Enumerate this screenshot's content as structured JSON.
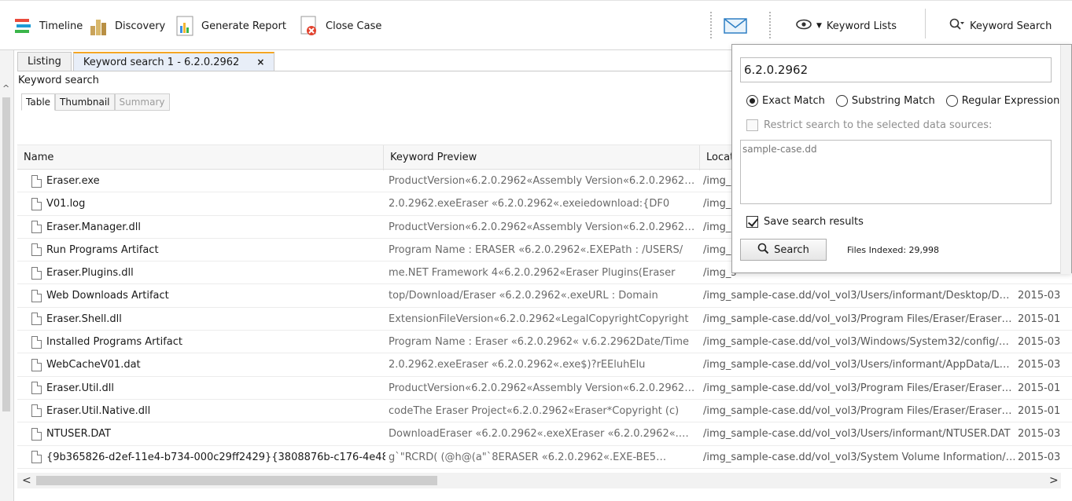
{
  "toolbar": {
    "timeline": "Timeline",
    "discovery": "Discovery",
    "generate_report": "Generate Report",
    "close_case": "Close Case",
    "keyword_lists": "Keyword Lists",
    "keyword_search": "Keyword Search"
  },
  "tabs": {
    "listing": "Listing",
    "keyword_search": "Keyword search 1 - 6.2.0.2962",
    "close": "×"
  },
  "section_label": "Keyword search",
  "subtabs": {
    "table": "Table",
    "thumbnail": "Thumbnail",
    "summary": "Summary"
  },
  "table": {
    "headers": {
      "name": "Name",
      "preview": "Keyword Preview",
      "location": "Locat"
    },
    "rows": [
      {
        "name": "Eraser.exe",
        "preview": "ProductVersion«6.2.0.2962«Assembly Version«6.2.0.2962…",
        "location": "/img_s",
        "date": ""
      },
      {
        "name": "V01.log",
        "preview": "2.0.2962.exeEraser «6.2.0.2962«.exeiedownload:{DF0",
        "location": "/img_s",
        "date": ""
      },
      {
        "name": "Eraser.Manager.dll",
        "preview": "ProductVersion«6.2.0.2962«Assembly Version«6.2.0.2962…",
        "location": "/img_s",
        "date": ""
      },
      {
        "name": "Run Programs Artifact",
        "preview": "Program Name : ERASER «6.2.0.2962«.EXEPath : /USERS/",
        "location": "/img_s",
        "date": ""
      },
      {
        "name": "Eraser.Plugins.dll",
        "preview": "me.NET Framework 4«6.2.0.2962«Eraser Plugins(Eraser",
        "location": "/img_s",
        "date": ""
      },
      {
        "name": "Web Downloads Artifact",
        "preview": "top/Download/Eraser «6.2.0.2962«.exeURL : Domain",
        "location": "/img_sample-case.dd/vol_vol3/Users/informant/Desktop/D…",
        "date": "2015-03"
      },
      {
        "name": "Eraser.Shell.dll",
        "preview": "ExtensionFileVersion«6.2.0.2962«LegalCopyrightCopyright",
        "location": "/img_sample-case.dd/vol_vol3/Program Files/Eraser/Eraser…",
        "date": "2015-01"
      },
      {
        "name": "Installed Programs Artifact",
        "preview": "Program Name : Eraser «6.2.0.2962« v.6.2.2962Date/Time",
        "location": "/img_sample-case.dd/vol_vol3/Windows/System32/config/…",
        "date": "2015-03"
      },
      {
        "name": "WebCacheV01.dat",
        "preview": "2.0.2962.exeEraser «6.2.0.2962«.exe$)?rEEluhElu",
        "location": "/img_sample-case.dd/vol_vol3/Users/informant/AppData/L…",
        "date": "2015-03"
      },
      {
        "name": "Eraser.Util.dll",
        "preview": "ProductVersion«6.2.0.2962«Assembly Version«6.2.0.2962…",
        "location": "/img_sample-case.dd/vol_vol3/Program Files/Eraser/Eraser…",
        "date": "2015-01"
      },
      {
        "name": "Eraser.Util.Native.dll",
        "preview": "codeThe Eraser Project«6.2.0.2962«Eraser*Copyright (c)",
        "location": "/img_sample-case.dd/vol_vol3/Program Files/Eraser/Eraser…",
        "date": "2015-01"
      },
      {
        "name": "NTUSER.DAT",
        "preview": "DownloadEraser «6.2.0.2962«.exeXEraser «6.2.0.2962«.…",
        "location": "/img_sample-case.dd/vol_vol3/Users/informant/NTUSER.DAT",
        "date": "2015-03"
      },
      {
        "name": "{9b365826-d2ef-11e4-b734-000c29ff2429}{3808876b-c176-4e48",
        "preview": "g`\"RCRD(      (@h@(a\"`8ERASER «6.2.0.2962«.EXE-BE5…",
        "location": "/img_sample-case.dd/vol_vol3/System Volume Information/…",
        "date": "2015-03"
      }
    ]
  },
  "popup": {
    "query": "6.2.0.2962",
    "exact_match": "Exact Match",
    "substring_match": "Substring Match",
    "regular_expression": "Regular Expression",
    "restrict_label": "Restrict search to the selected data sources:",
    "data_source": "sample-case.dd",
    "save_results": "Save search results",
    "search_button": "Search",
    "files_indexed": "Files Indexed: 29,998"
  },
  "colors": {
    "active_tab_accent": "#f5a623",
    "preview_text": "#6a6a6a"
  }
}
